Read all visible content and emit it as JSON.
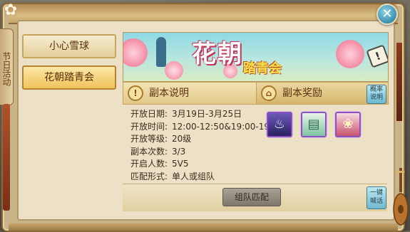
{
  "window": {
    "side_tab_label": "节日活动",
    "close_label": "✕"
  },
  "menu": {
    "items": [
      {
        "label": "小心雪球",
        "active": false
      },
      {
        "label": "花朝踏青会",
        "active": true
      }
    ]
  },
  "banner": {
    "title": "花朝",
    "subtitle": "踏青会",
    "info_label": "!"
  },
  "sections": {
    "desc_title": "副本说明",
    "reward_title": "副本奖励",
    "prob_button": "概率说明"
  },
  "details": {
    "rows": [
      {
        "key": "开放日期:",
        "value": "3月19日-3月25日"
      },
      {
        "key": "开放时间:",
        "value": "12:00-12:50&19:00-19:50"
      },
      {
        "key": "开放等级:",
        "value": "20级"
      },
      {
        "key": "副本次数:",
        "value": "3/3"
      },
      {
        "key": "开启人数:",
        "value": "5V5"
      },
      {
        "key": "匹配形式:",
        "value": "单人或组队"
      }
    ]
  },
  "rewards": [
    {
      "icon": "lotus-lamp-icon",
      "color": "#4a3a8c"
    },
    {
      "icon": "scroll-icon",
      "color": "#3d8a6a"
    },
    {
      "icon": "gift-box-icon",
      "color": "#a0324a"
    }
  ],
  "actions": {
    "team_match": "组队匹配",
    "one_key": "一键喊话"
  }
}
